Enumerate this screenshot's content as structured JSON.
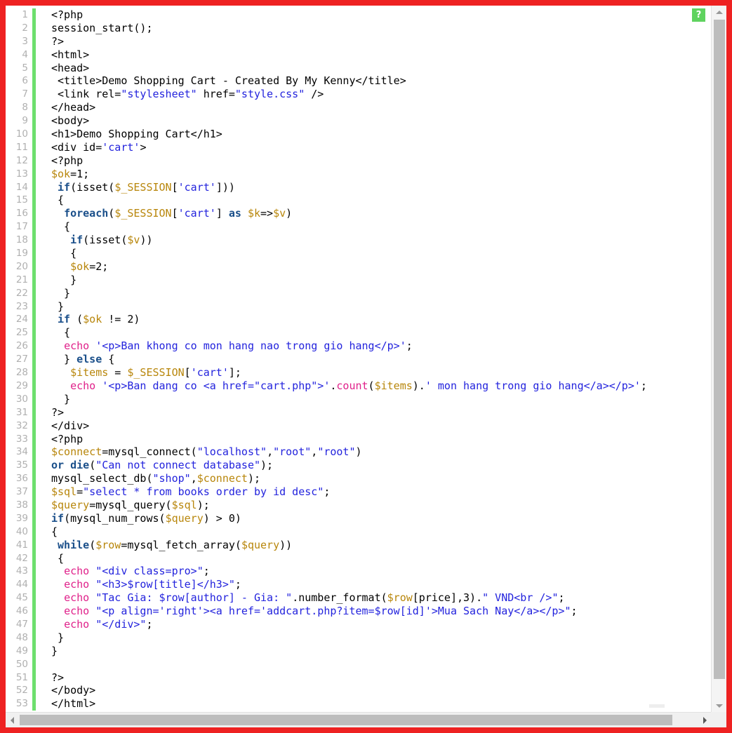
{
  "editor": {
    "border_color": "#ee2222",
    "background": "#ffffff",
    "change_bar_color": "#6ddf6d",
    "line_number_color": "#b0b0b0",
    "total_lines": 53,
    "first_visible_line": 1,
    "last_visible_line": 53
  },
  "badge": {
    "label": "?",
    "color": "#5fd35f"
  },
  "syntax_colors": {
    "keyword": "#1a4f8a",
    "variable": "#b8860b",
    "string": "#2323dd",
    "function": "#e0218a",
    "plain": "#000000"
  },
  "scrollbars": {
    "vertical_up_arrow": "arrow-up-icon",
    "vertical_down_arrow": "arrow-down-icon",
    "horizontal_left_arrow": "arrow-left-icon",
    "horizontal_right_arrow": "arrow-right-icon"
  },
  "code": {
    "language": "php",
    "lines": [
      {
        "n": 1,
        "tokens": [
          {
            "t": "<?php",
            "c": "plain"
          }
        ]
      },
      {
        "n": 2,
        "tokens": [
          {
            "t": "session_start();",
            "c": "plain"
          }
        ]
      },
      {
        "n": 3,
        "tokens": [
          {
            "t": "?>",
            "c": "plain"
          }
        ]
      },
      {
        "n": 4,
        "tokens": [
          {
            "t": "<html>",
            "c": "plain"
          }
        ]
      },
      {
        "n": 5,
        "tokens": [
          {
            "t": "<head>",
            "c": "plain"
          }
        ]
      },
      {
        "n": 6,
        "tokens": [
          {
            "t": " <title>Demo Shopping Cart - Created By My Kenny</title>",
            "c": "plain"
          }
        ]
      },
      {
        "n": 7,
        "tokens": [
          {
            "t": " <link rel=",
            "c": "plain"
          },
          {
            "t": "\"stylesheet\"",
            "c": "string"
          },
          {
            "t": " href=",
            "c": "plain"
          },
          {
            "t": "\"style.css\"",
            "c": "string"
          },
          {
            "t": " />",
            "c": "plain"
          }
        ]
      },
      {
        "n": 8,
        "tokens": [
          {
            "t": "</head>",
            "c": "plain"
          }
        ]
      },
      {
        "n": 9,
        "tokens": [
          {
            "t": "<body>",
            "c": "plain"
          }
        ]
      },
      {
        "n": 10,
        "tokens": [
          {
            "t": "<h1>Demo Shopping Cart</h1>",
            "c": "plain"
          }
        ]
      },
      {
        "n": 11,
        "tokens": [
          {
            "t": "<div id=",
            "c": "plain"
          },
          {
            "t": "'cart'",
            "c": "string"
          },
          {
            "t": ">",
            "c": "plain"
          }
        ]
      },
      {
        "n": 12,
        "tokens": [
          {
            "t": "<?php",
            "c": "plain"
          }
        ]
      },
      {
        "n": 13,
        "tokens": [
          {
            "t": "$ok",
            "c": "variable"
          },
          {
            "t": "=1;",
            "c": "plain"
          }
        ]
      },
      {
        "n": 14,
        "tokens": [
          {
            "t": " ",
            "c": "plain"
          },
          {
            "t": "if",
            "c": "keyword"
          },
          {
            "t": "(isset(",
            "c": "plain"
          },
          {
            "t": "$_SESSION",
            "c": "variable"
          },
          {
            "t": "[",
            "c": "plain"
          },
          {
            "t": "'cart'",
            "c": "string"
          },
          {
            "t": "]))",
            "c": "plain"
          }
        ]
      },
      {
        "n": 15,
        "tokens": [
          {
            "t": " {",
            "c": "plain"
          }
        ]
      },
      {
        "n": 16,
        "tokens": [
          {
            "t": "  ",
            "c": "plain"
          },
          {
            "t": "foreach",
            "c": "keyword"
          },
          {
            "t": "(",
            "c": "plain"
          },
          {
            "t": "$_SESSION",
            "c": "variable"
          },
          {
            "t": "[",
            "c": "plain"
          },
          {
            "t": "'cart'",
            "c": "string"
          },
          {
            "t": "] ",
            "c": "plain"
          },
          {
            "t": "as",
            "c": "keyword"
          },
          {
            "t": " ",
            "c": "plain"
          },
          {
            "t": "$k",
            "c": "variable"
          },
          {
            "t": "=>",
            "c": "plain"
          },
          {
            "t": "$v",
            "c": "variable"
          },
          {
            "t": ")",
            "c": "plain"
          }
        ]
      },
      {
        "n": 17,
        "tokens": [
          {
            "t": "  {",
            "c": "plain"
          }
        ]
      },
      {
        "n": 18,
        "tokens": [
          {
            "t": "   ",
            "c": "plain"
          },
          {
            "t": "if",
            "c": "keyword"
          },
          {
            "t": "(isset(",
            "c": "plain"
          },
          {
            "t": "$v",
            "c": "variable"
          },
          {
            "t": "))",
            "c": "plain"
          }
        ]
      },
      {
        "n": 19,
        "tokens": [
          {
            "t": "   {",
            "c": "plain"
          }
        ]
      },
      {
        "n": 20,
        "tokens": [
          {
            "t": "   ",
            "c": "plain"
          },
          {
            "t": "$ok",
            "c": "variable"
          },
          {
            "t": "=2;",
            "c": "plain"
          }
        ]
      },
      {
        "n": 21,
        "tokens": [
          {
            "t": "   }",
            "c": "plain"
          }
        ]
      },
      {
        "n": 22,
        "tokens": [
          {
            "t": "  }",
            "c": "plain"
          }
        ]
      },
      {
        "n": 23,
        "tokens": [
          {
            "t": " }",
            "c": "plain"
          }
        ]
      },
      {
        "n": 24,
        "tokens": [
          {
            "t": " ",
            "c": "plain"
          },
          {
            "t": "if",
            "c": "keyword"
          },
          {
            "t": " (",
            "c": "plain"
          },
          {
            "t": "$ok",
            "c": "variable"
          },
          {
            "t": " != 2)",
            "c": "plain"
          }
        ]
      },
      {
        "n": 25,
        "tokens": [
          {
            "t": "  {",
            "c": "plain"
          }
        ]
      },
      {
        "n": 26,
        "tokens": [
          {
            "t": "  ",
            "c": "plain"
          },
          {
            "t": "echo",
            "c": "function"
          },
          {
            "t": " ",
            "c": "plain"
          },
          {
            "t": "'<p>Ban khong co mon hang nao trong gio hang</p>'",
            "c": "string"
          },
          {
            "t": ";",
            "c": "plain"
          }
        ]
      },
      {
        "n": 27,
        "tokens": [
          {
            "t": "  } ",
            "c": "plain"
          },
          {
            "t": "else",
            "c": "keyword"
          },
          {
            "t": " {",
            "c": "plain"
          }
        ]
      },
      {
        "n": 28,
        "tokens": [
          {
            "t": "   ",
            "c": "plain"
          },
          {
            "t": "$items",
            "c": "variable"
          },
          {
            "t": " = ",
            "c": "plain"
          },
          {
            "t": "$_SESSION",
            "c": "variable"
          },
          {
            "t": "[",
            "c": "plain"
          },
          {
            "t": "'cart'",
            "c": "string"
          },
          {
            "t": "];",
            "c": "plain"
          }
        ]
      },
      {
        "n": 29,
        "tokens": [
          {
            "t": "   ",
            "c": "plain"
          },
          {
            "t": "echo",
            "c": "function"
          },
          {
            "t": " ",
            "c": "plain"
          },
          {
            "t": "'<p>Ban dang co <a href=\"cart.php\">'",
            "c": "string"
          },
          {
            "t": ".",
            "c": "plain"
          },
          {
            "t": "count",
            "c": "function"
          },
          {
            "t": "(",
            "c": "plain"
          },
          {
            "t": "$items",
            "c": "variable"
          },
          {
            "t": ").",
            "c": "plain"
          },
          {
            "t": "' mon hang trong gio hang</a></p>'",
            "c": "string"
          },
          {
            "t": ";",
            "c": "plain"
          }
        ]
      },
      {
        "n": 30,
        "tokens": [
          {
            "t": "  }",
            "c": "plain"
          }
        ]
      },
      {
        "n": 31,
        "tokens": [
          {
            "t": "?>",
            "c": "plain"
          }
        ]
      },
      {
        "n": 32,
        "tokens": [
          {
            "t": "</div>",
            "c": "plain"
          }
        ]
      },
      {
        "n": 33,
        "tokens": [
          {
            "t": "<?php",
            "c": "plain"
          }
        ]
      },
      {
        "n": 34,
        "tokens": [
          {
            "t": "$connect",
            "c": "variable"
          },
          {
            "t": "=mysql_connect(",
            "c": "plain"
          },
          {
            "t": "\"localhost\"",
            "c": "string"
          },
          {
            "t": ",",
            "c": "plain"
          },
          {
            "t": "\"root\"",
            "c": "string"
          },
          {
            "t": ",",
            "c": "plain"
          },
          {
            "t": "\"root\"",
            "c": "string"
          },
          {
            "t": ")",
            "c": "plain"
          }
        ]
      },
      {
        "n": 35,
        "tokens": [
          {
            "t": "or",
            "c": "keyword"
          },
          {
            "t": " ",
            "c": "plain"
          },
          {
            "t": "die",
            "c": "keyword"
          },
          {
            "t": "(",
            "c": "plain"
          },
          {
            "t": "\"Can not connect database\"",
            "c": "string"
          },
          {
            "t": ");",
            "c": "plain"
          }
        ]
      },
      {
        "n": 36,
        "tokens": [
          {
            "t": "mysql_select_db(",
            "c": "plain"
          },
          {
            "t": "\"shop\"",
            "c": "string"
          },
          {
            "t": ",",
            "c": "plain"
          },
          {
            "t": "$connect",
            "c": "variable"
          },
          {
            "t": ");",
            "c": "plain"
          }
        ]
      },
      {
        "n": 37,
        "tokens": [
          {
            "t": "$sql",
            "c": "variable"
          },
          {
            "t": "=",
            "c": "plain"
          },
          {
            "t": "\"select * from books order by id desc\"",
            "c": "string"
          },
          {
            "t": ";",
            "c": "plain"
          }
        ]
      },
      {
        "n": 38,
        "tokens": [
          {
            "t": "$query",
            "c": "variable"
          },
          {
            "t": "=mysql_query(",
            "c": "plain"
          },
          {
            "t": "$sql",
            "c": "variable"
          },
          {
            "t": ");",
            "c": "plain"
          }
        ]
      },
      {
        "n": 39,
        "tokens": [
          {
            "t": "if",
            "c": "keyword"
          },
          {
            "t": "(mysql_num_rows(",
            "c": "plain"
          },
          {
            "t": "$query",
            "c": "variable"
          },
          {
            "t": ") > 0)",
            "c": "plain"
          }
        ]
      },
      {
        "n": 40,
        "tokens": [
          {
            "t": "{",
            "c": "plain"
          }
        ]
      },
      {
        "n": 41,
        "tokens": [
          {
            "t": " ",
            "c": "plain"
          },
          {
            "t": "while",
            "c": "keyword"
          },
          {
            "t": "(",
            "c": "plain"
          },
          {
            "t": "$row",
            "c": "variable"
          },
          {
            "t": "=mysql_fetch_array(",
            "c": "plain"
          },
          {
            "t": "$query",
            "c": "variable"
          },
          {
            "t": "))",
            "c": "plain"
          }
        ]
      },
      {
        "n": 42,
        "tokens": [
          {
            "t": " {",
            "c": "plain"
          }
        ]
      },
      {
        "n": 43,
        "tokens": [
          {
            "t": "  ",
            "c": "plain"
          },
          {
            "t": "echo",
            "c": "function"
          },
          {
            "t": " ",
            "c": "plain"
          },
          {
            "t": "\"<div class=pro>\"",
            "c": "string"
          },
          {
            "t": ";",
            "c": "plain"
          }
        ]
      },
      {
        "n": 44,
        "tokens": [
          {
            "t": "  ",
            "c": "plain"
          },
          {
            "t": "echo",
            "c": "function"
          },
          {
            "t": " ",
            "c": "plain"
          },
          {
            "t": "\"<h3>$row[title]</h3>\"",
            "c": "string"
          },
          {
            "t": ";",
            "c": "plain"
          }
        ]
      },
      {
        "n": 45,
        "tokens": [
          {
            "t": "  ",
            "c": "plain"
          },
          {
            "t": "echo",
            "c": "function"
          },
          {
            "t": " ",
            "c": "plain"
          },
          {
            "t": "\"Tac Gia: $row[author] - Gia: \"",
            "c": "string"
          },
          {
            "t": ".number_format(",
            "c": "plain"
          },
          {
            "t": "$row",
            "c": "variable"
          },
          {
            "t": "[price],3).",
            "c": "plain"
          },
          {
            "t": "\" VND<br />\"",
            "c": "string"
          },
          {
            "t": ";",
            "c": "plain"
          }
        ]
      },
      {
        "n": 46,
        "tokens": [
          {
            "t": "  ",
            "c": "plain"
          },
          {
            "t": "echo",
            "c": "function"
          },
          {
            "t": " ",
            "c": "plain"
          },
          {
            "t": "\"<p align='right'><a href='addcart.php?item=$row[id]'>Mua Sach Nay</a></p>\"",
            "c": "string"
          },
          {
            "t": ";",
            "c": "plain"
          }
        ]
      },
      {
        "n": 47,
        "tokens": [
          {
            "t": "  ",
            "c": "plain"
          },
          {
            "t": "echo",
            "c": "function"
          },
          {
            "t": " ",
            "c": "plain"
          },
          {
            "t": "\"</div>\"",
            "c": "string"
          },
          {
            "t": ";",
            "c": "plain"
          }
        ]
      },
      {
        "n": 48,
        "tokens": [
          {
            "t": " }",
            "c": "plain"
          }
        ]
      },
      {
        "n": 49,
        "tokens": [
          {
            "t": "}",
            "c": "plain"
          }
        ]
      },
      {
        "n": 50,
        "tokens": [
          {
            "t": "",
            "c": "plain"
          }
        ]
      },
      {
        "n": 51,
        "tokens": [
          {
            "t": "?>",
            "c": "plain"
          }
        ]
      },
      {
        "n": 52,
        "tokens": [
          {
            "t": "</body>",
            "c": "plain"
          }
        ]
      },
      {
        "n": 53,
        "tokens": [
          {
            "t": "</html>",
            "c": "plain"
          }
        ]
      }
    ]
  }
}
